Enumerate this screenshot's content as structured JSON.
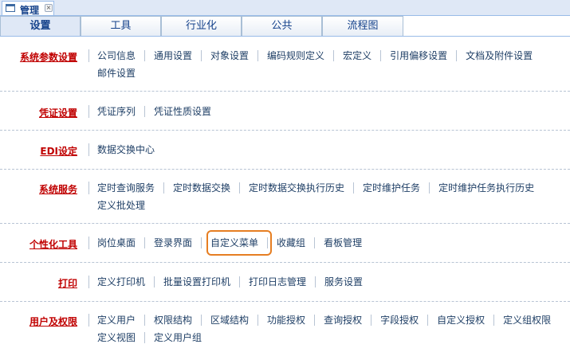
{
  "window": {
    "tab_title": "管理",
    "close_glyph": "×"
  },
  "tabs": [
    {
      "label": "设置",
      "active": true
    },
    {
      "label": "工具",
      "active": false
    },
    {
      "label": "行业化",
      "active": false
    },
    {
      "label": "公共",
      "active": false
    },
    {
      "label": "流程图",
      "active": false
    }
  ],
  "sections": [
    {
      "title": "系统参数设置",
      "items": [
        "公司信息",
        "通用设置",
        "对象设置",
        "编码规则定义",
        "宏定义",
        "引用偏移设置",
        "文档及附件设置",
        "邮件设置"
      ]
    },
    {
      "title": "凭证设置",
      "items": [
        "凭证序列",
        "凭证性质设置"
      ]
    },
    {
      "title": "EDI设定",
      "items": [
        "数据交换中心"
      ]
    },
    {
      "title": "系统服务",
      "items": [
        "定时查询服务",
        "定时数据交换",
        "定时数据交换执行历史",
        "定时维护任务",
        "定时维护任务执行历史",
        "定义批处理"
      ]
    },
    {
      "title": "个性化工具",
      "items": [
        "岗位桌面",
        "登录界面",
        "自定义菜单",
        "收藏组",
        "看板管理"
      ],
      "highlighted": "自定义菜单"
    },
    {
      "title": "打印",
      "items": [
        "定义打印机",
        "批量设置打印机",
        "打印日志管理",
        "服务设置"
      ]
    },
    {
      "title": "用户及权限",
      "items": [
        "定义用户",
        "权限结构",
        "区域结构",
        "功能授权",
        "查询授权",
        "字段授权",
        "自定义授权",
        "定义组权限",
        "定义视图",
        "定义用户组"
      ]
    }
  ],
  "colors": {
    "section_title": "#c00000",
    "link": "#1f3f66",
    "highlight_border": "#e67e22",
    "tab_bg": "#dfe8f6"
  }
}
